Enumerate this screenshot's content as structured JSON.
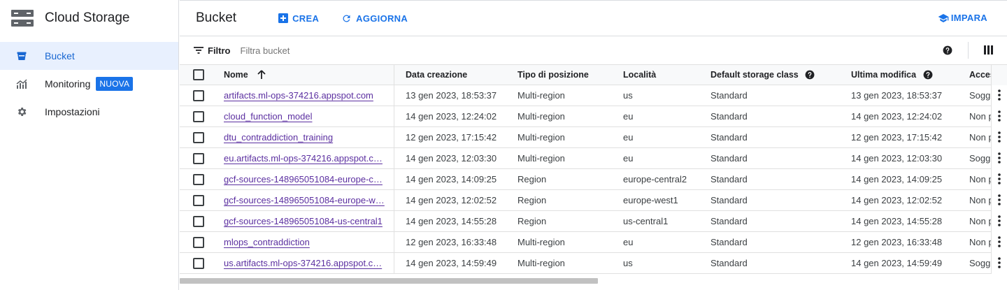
{
  "sidebar": {
    "title": "Cloud Storage",
    "logo_icon": "storage-server-icon",
    "items": [
      {
        "label": "Bucket",
        "icon": "bucket-icon",
        "active": true
      },
      {
        "label": "Monitoring",
        "icon": "monitoring-chart-icon",
        "badge": "NUOVA"
      },
      {
        "label": "Impostazioni",
        "icon": "gear-icon"
      }
    ]
  },
  "header": {
    "title": "Bucket",
    "create_label": "CREA",
    "refresh_label": "AGGIORNA",
    "learn_label": "IMPARA"
  },
  "filter": {
    "label": "Filtro",
    "placeholder": "Filtra bucket"
  },
  "table": {
    "columns": {
      "name": "Nome",
      "created": "Data creazione",
      "location_type": "Tipo di posizione",
      "location": "Località",
      "storage_class": "Default storage class",
      "modified": "Ultima modifica",
      "access": "Acces"
    },
    "rows": [
      {
        "name": "artifacts.ml-ops-374216.appspot.com",
        "created": "13 gen 2023, 18:53:37",
        "location_type": "Multi-region",
        "location": "us",
        "storage_class": "Standard",
        "modified": "13 gen 2023, 18:53:37",
        "access": "Sogg"
      },
      {
        "name": "cloud_function_model",
        "created": "14 gen 2023, 12:24:02",
        "location_type": "Multi-region",
        "location": "eu",
        "storage_class": "Standard",
        "modified": "14 gen 2023, 12:24:02",
        "access": "Non p"
      },
      {
        "name": "dtu_contraddiction_training",
        "created": "12 gen 2023, 17:15:42",
        "location_type": "Multi-region",
        "location": "eu",
        "storage_class": "Standard",
        "modified": "12 gen 2023, 17:15:42",
        "access": "Non p"
      },
      {
        "name": "eu.artifacts.ml-ops-374216.appspot.c…",
        "created": "14 gen 2023, 12:03:30",
        "location_type": "Multi-region",
        "location": "eu",
        "storage_class": "Standard",
        "modified": "14 gen 2023, 12:03:30",
        "access": "Sogg"
      },
      {
        "name": "gcf-sources-148965051084-europe-c…",
        "created": "14 gen 2023, 14:09:25",
        "location_type": "Region",
        "location": "europe-central2",
        "storage_class": "Standard",
        "modified": "14 gen 2023, 14:09:25",
        "access": "Non p"
      },
      {
        "name": "gcf-sources-148965051084-europe-w…",
        "created": "14 gen 2023, 12:02:52",
        "location_type": "Region",
        "location": "europe-west1",
        "storage_class": "Standard",
        "modified": "14 gen 2023, 12:02:52",
        "access": "Non p"
      },
      {
        "name": "gcf-sources-148965051084-us-central1",
        "created": "14 gen 2023, 14:55:28",
        "location_type": "Region",
        "location": "us-central1",
        "storage_class": "Standard",
        "modified": "14 gen 2023, 14:55:28",
        "access": "Non p"
      },
      {
        "name": "mlops_contraddiction",
        "created": "12 gen 2023, 16:33:48",
        "location_type": "Multi-region",
        "location": "eu",
        "storage_class": "Standard",
        "modified": "12 gen 2023, 16:33:48",
        "access": "Non p"
      },
      {
        "name": "us.artifacts.ml-ops-374216.appspot.c…",
        "created": "14 gen 2023, 14:59:49",
        "location_type": "Multi-region",
        "location": "us",
        "storage_class": "Standard",
        "modified": "14 gen 2023, 14:59:49",
        "access": "Sogg"
      }
    ]
  },
  "colors": {
    "accent": "#1a73e8",
    "link": "#5b2fa0",
    "active_bg": "#e8f0fe"
  }
}
